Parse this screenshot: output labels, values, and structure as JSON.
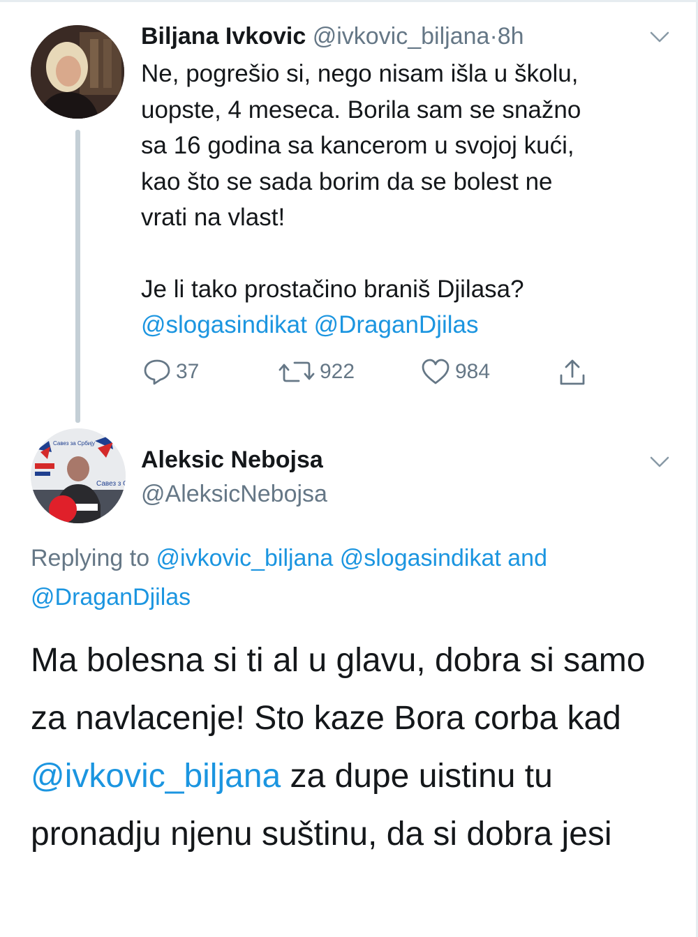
{
  "tweet1": {
    "name": "Biljana Ivkovic",
    "handle": "@ivkovic_biljana",
    "sep": "·",
    "time": "8h",
    "lines": [
      "Ne, pogrešio si, nego nisam išla u školu,",
      "uopste, 4 meseca. Borila sam se snažno",
      "sa 16 godina sa kancerom u svojoj kući,",
      "kao što se sada borim da se bolest ne",
      "vrati na vlast!"
    ],
    "question": "Je li tako prostačino braniš Djilasa?",
    "mentions": "@slogasindikat @DraganDjilas",
    "replies": "37",
    "retweets": "922",
    "likes": "984"
  },
  "tweet2": {
    "name": "Aleksic Nebojsa",
    "handle": "@AleksicNebojsa",
    "avatar_text_1": "Савез за Србију",
    "avatar_text_2": "Савез з Србију",
    "replying_prefix": "Replying to ",
    "replying_mentions_1": "@ivkovic_biljana @slogasindikat",
    "replying_and": " and",
    "replying_mentions_2": "@DraganDjilas",
    "text_a": "Ma bolesna si ti al u glavu, dobra si samo za navlacenje! Sto kaze Bora corba kad ",
    "text_mention": "@ivkovic_biljana",
    "text_b": " za dupe uistinu tu pronadju njenu suštinu, da si dobra jesi"
  },
  "colors": {
    "text": "#14171a",
    "secondary": "#657786",
    "link": "#1b95e0",
    "thread_line": "#c4cfd6"
  },
  "icons": [
    "reply-icon",
    "retweet-icon",
    "like-icon",
    "share-icon",
    "chevron-down-icon"
  ]
}
